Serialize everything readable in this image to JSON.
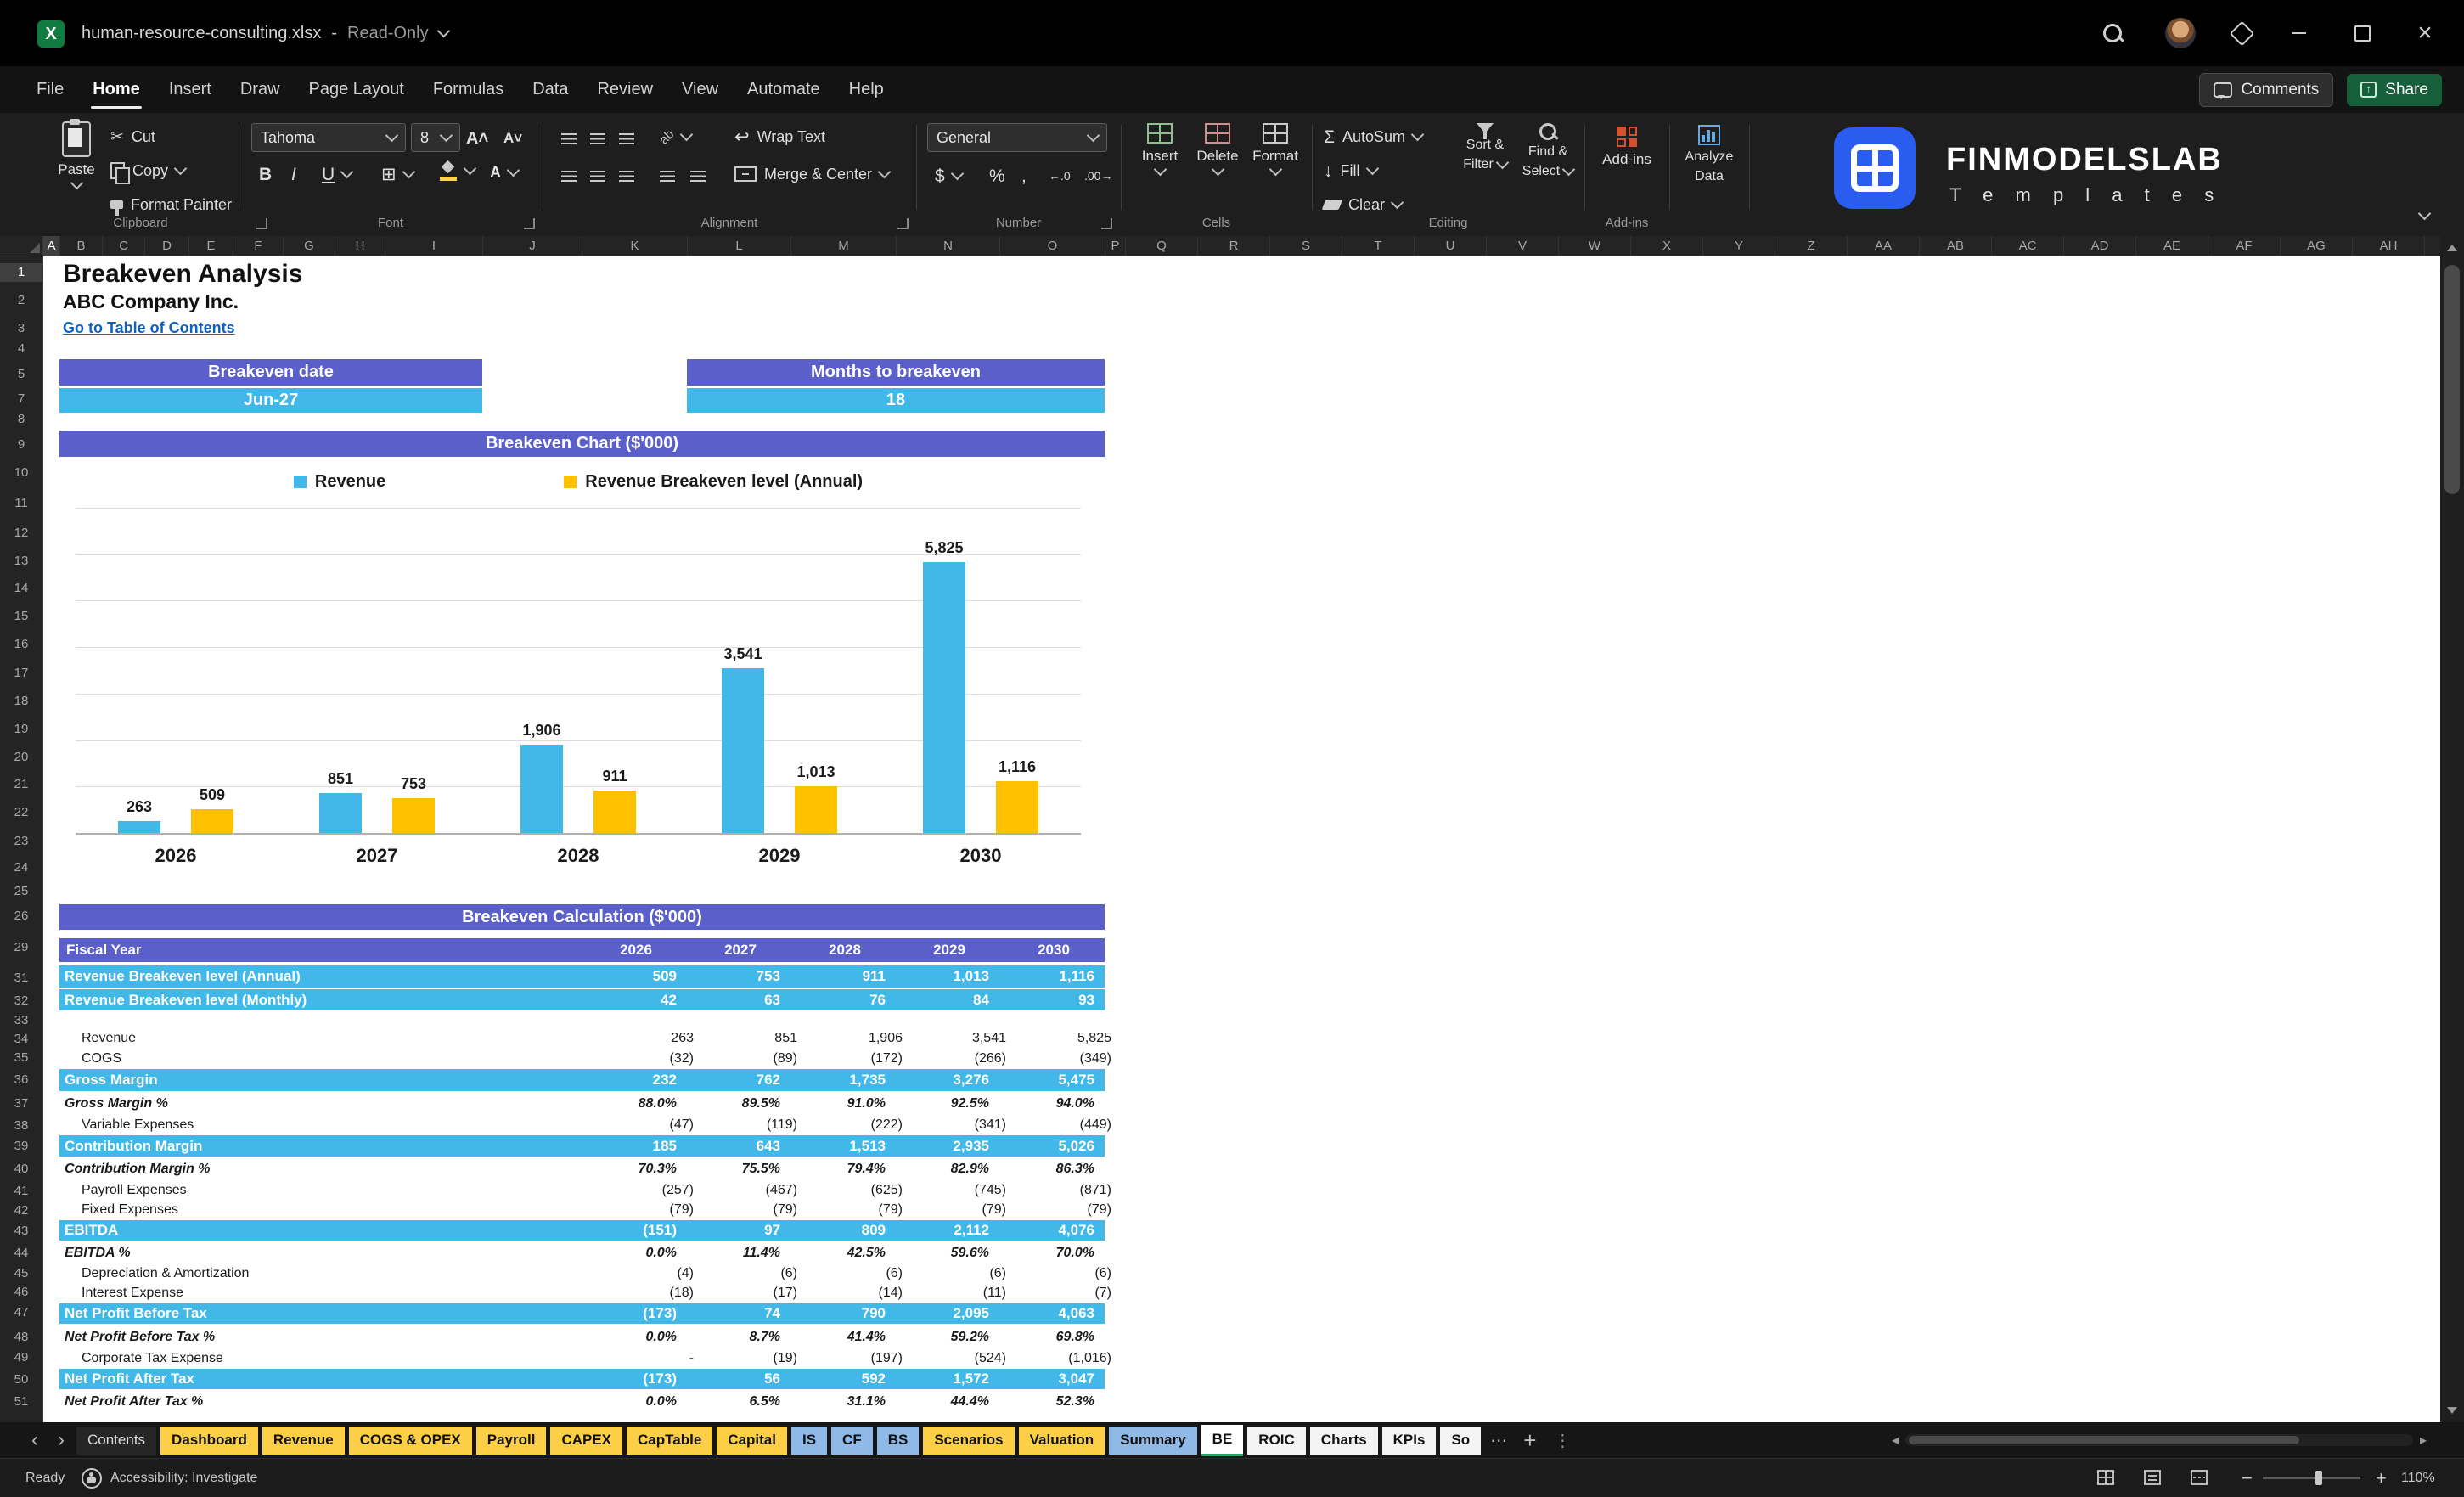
{
  "titlebar": {
    "filename": "human-resource-consulting.xlsx",
    "separator": "-",
    "mode": "Read-Only"
  },
  "menubar": {
    "items": [
      "File",
      "Home",
      "Insert",
      "Draw",
      "Page Layout",
      "Formulas",
      "Data",
      "Review",
      "View",
      "Automate",
      "Help"
    ],
    "active": "Home",
    "comments": "Comments",
    "share": "Share"
  },
  "ribbon": {
    "groups": {
      "clipboard": "Clipboard",
      "font": "Font",
      "alignment": "Alignment",
      "number": "Number",
      "cells": "Cells",
      "editing": "Editing",
      "addins": "Add-ins"
    },
    "paste": "Paste",
    "cut": "Cut",
    "copy": "Copy",
    "format_painter": "Format Painter",
    "font_name": "Tahoma",
    "font_size": "8",
    "bold": "B",
    "italic": "I",
    "underline": "U",
    "wrap_text": "Wrap Text",
    "merge_center": "Merge & Center",
    "number_format": "General",
    "currency": "$",
    "percent": "%",
    "comma": ",",
    "insert": "Insert",
    "delete": "Delete",
    "format": "Format",
    "autosum": "AutoSum",
    "fill": "Fill",
    "clear": "Clear",
    "sort_line1": "Sort &",
    "sort_line2": "Filter",
    "find_line1": "Find &",
    "find_line2": "Select",
    "addins_label": "Add-ins",
    "analyze_line1": "Analyze",
    "analyze_line2": "Data",
    "brand_name": "FINMODELSLAB",
    "brand_sub": "T e m p l a t e s"
  },
  "grid": {
    "columns": [
      "A",
      "B",
      "C",
      "D",
      "E",
      "F",
      "G",
      "H",
      "I",
      "J",
      "K",
      "L",
      "M",
      "N",
      "O",
      "P",
      "Q",
      "R",
      "S",
      "T",
      "U",
      "V",
      "W",
      "X",
      "Y",
      "Z",
      "AA",
      "AB",
      "AC",
      "AD",
      "AE",
      "AF",
      "AG",
      "AH"
    ],
    "rows": [
      1,
      2,
      3,
      4,
      5,
      7,
      8,
      9,
      10,
      11,
      12,
      13,
      14,
      15,
      16,
      17,
      18,
      19,
      20,
      21,
      22,
      23,
      24,
      25,
      26,
      29,
      31,
      32,
      33,
      34,
      35,
      36,
      37,
      38,
      39,
      40,
      41,
      42,
      43,
      44,
      45,
      46,
      47,
      48,
      49,
      50,
      51
    ]
  },
  "sheet": {
    "title": "Breakeven Analysis",
    "company": "ABC Company Inc.",
    "link": "Go to Table of Contents",
    "breakeven_date_label": "Breakeven date",
    "breakeven_date": "Jun-27",
    "months_label": "Months to breakeven",
    "months": "18",
    "chart_title": "Breakeven Chart ($'000)",
    "calc_title": "Breakeven Calculation ($'000)"
  },
  "colors": {
    "banner_purple": "#5a5fc9",
    "highlight_blue": "#41b8e8",
    "chart_blue": "#41b8e8",
    "chart_yellow": "#ffc000",
    "tab_yellow": "#fccf47",
    "tab_blue": "#8fb9e6"
  },
  "chart_data": {
    "type": "bar",
    "title": "Breakeven Chart ($'000)",
    "categories": [
      "2026",
      "2027",
      "2028",
      "2029",
      "2030"
    ],
    "series": [
      {
        "name": "Revenue",
        "color": "#41b8e8",
        "values": [
          263,
          851,
          1906,
          3541,
          5825
        ],
        "labels": [
          "263",
          "851",
          "1,906",
          "3,541",
          "5,825"
        ]
      },
      {
        "name": "Revenue Breakeven level (Annual)",
        "color": "#ffc000",
        "values": [
          509,
          753,
          911,
          1013,
          1116
        ],
        "labels": [
          "509",
          "753",
          "911",
          "1,013",
          "1,116"
        ]
      }
    ],
    "ylim": [
      0,
      7000
    ],
    "gridline_step": 1000,
    "legend_position": "top",
    "grid": true
  },
  "table": {
    "header": {
      "label": "Fiscal Year",
      "years": [
        "2026",
        "2027",
        "2028",
        "2029",
        "2030"
      ]
    },
    "rows": [
      {
        "label": "Revenue Breakeven level (Annual)",
        "style": "highlight",
        "values": [
          "509",
          "753",
          "911",
          "1,013",
          "1,116"
        ]
      },
      {
        "label": "Revenue Breakeven level (Monthly)",
        "style": "highlight",
        "values": [
          "42",
          "63",
          "76",
          "84",
          "93"
        ]
      },
      {
        "style": "gap"
      },
      {
        "label": "Revenue",
        "style": "normal",
        "values": [
          "263",
          "851",
          "1,906",
          "3,541",
          "5,825"
        ]
      },
      {
        "label": "COGS",
        "style": "normal",
        "values": [
          "(32)",
          "(89)",
          "(172)",
          "(266)",
          "(349)"
        ]
      },
      {
        "label": "Gross Margin",
        "style": "highlight",
        "values": [
          "232",
          "762",
          "1,735",
          "3,276",
          "5,475"
        ]
      },
      {
        "label": "Gross Margin %",
        "style": "percent",
        "values": [
          "88.0%",
          "89.5%",
          "91.0%",
          "92.5%",
          "94.0%"
        ]
      },
      {
        "label": "Variable Expenses",
        "style": "normal",
        "values": [
          "(47)",
          "(119)",
          "(222)",
          "(341)",
          "(449)"
        ]
      },
      {
        "label": "Contribution Margin",
        "style": "highlight",
        "values": [
          "185",
          "643",
          "1,513",
          "2,935",
          "5,026"
        ]
      },
      {
        "label": "Contribution Margin %",
        "style": "percent",
        "values": [
          "70.3%",
          "75.5%",
          "79.4%",
          "82.9%",
          "86.3%"
        ]
      },
      {
        "label": "Payroll Expenses",
        "style": "normal",
        "values": [
          "(257)",
          "(467)",
          "(625)",
          "(745)",
          "(871)"
        ]
      },
      {
        "label": "Fixed Expenses",
        "style": "normal",
        "values": [
          "(79)",
          "(79)",
          "(79)",
          "(79)",
          "(79)"
        ]
      },
      {
        "label": "EBITDA",
        "style": "highlight",
        "values": [
          "(151)",
          "97",
          "809",
          "2,112",
          "4,076"
        ]
      },
      {
        "label": "EBITDA %",
        "style": "percent",
        "values": [
          "0.0%",
          "11.4%",
          "42.5%",
          "59.6%",
          "70.0%"
        ]
      },
      {
        "label": "Depreciation & Amortization",
        "style": "normal",
        "values": [
          "(4)",
          "(6)",
          "(6)",
          "(6)",
          "(6)"
        ]
      },
      {
        "label": "Interest Expense",
        "style": "normal",
        "values": [
          "(18)",
          "(17)",
          "(14)",
          "(11)",
          "(7)"
        ]
      },
      {
        "label": "Net Profit Before Tax",
        "style": "highlight",
        "values": [
          "(173)",
          "74",
          "790",
          "2,095",
          "4,063"
        ]
      },
      {
        "label": "Net Profit Before Tax %",
        "style": "percent",
        "values": [
          "0.0%",
          "8.7%",
          "41.4%",
          "59.2%",
          "69.8%"
        ]
      },
      {
        "label": "Corporate Tax Expense",
        "style": "normal",
        "values": [
          "-",
          "(19)",
          "(197)",
          "(524)",
          "(1,016)"
        ]
      },
      {
        "label": "Net Profit After Tax",
        "style": "highlight",
        "values": [
          "(173)",
          "56",
          "592",
          "1,572",
          "3,047"
        ]
      },
      {
        "label": "Net Profit After Tax %",
        "style": "percent",
        "values": [
          "0.0%",
          "6.5%",
          "31.1%",
          "44.4%",
          "52.3%"
        ]
      }
    ]
  },
  "tabs": {
    "items": [
      {
        "label": "Contents",
        "color": "dark"
      },
      {
        "label": "Dashboard",
        "color": "yellow"
      },
      {
        "label": "Revenue",
        "color": "yellow"
      },
      {
        "label": "COGS & OPEX",
        "color": "yellow"
      },
      {
        "label": "Payroll",
        "color": "yellow"
      },
      {
        "label": "CAPEX",
        "color": "yellow"
      },
      {
        "label": "CapTable",
        "color": "yellow"
      },
      {
        "label": "Capital",
        "color": "yellow"
      },
      {
        "label": "IS",
        "color": "blue"
      },
      {
        "label": "CF",
        "color": "blue"
      },
      {
        "label": "BS",
        "color": "blue"
      },
      {
        "label": "Scenarios",
        "color": "yellow"
      },
      {
        "label": "Valuation",
        "color": "yellow"
      },
      {
        "label": "Summary",
        "color": "blue"
      },
      {
        "label": "BE",
        "color": "active"
      },
      {
        "label": "ROIC",
        "color": "white"
      },
      {
        "label": "Charts",
        "color": "white"
      },
      {
        "label": "KPIs",
        "color": "white"
      },
      {
        "label": "So",
        "color": "white"
      }
    ]
  },
  "statusbar": {
    "ready": "Ready",
    "accessibility": "Accessibility: Investigate",
    "zoom": "110%"
  }
}
